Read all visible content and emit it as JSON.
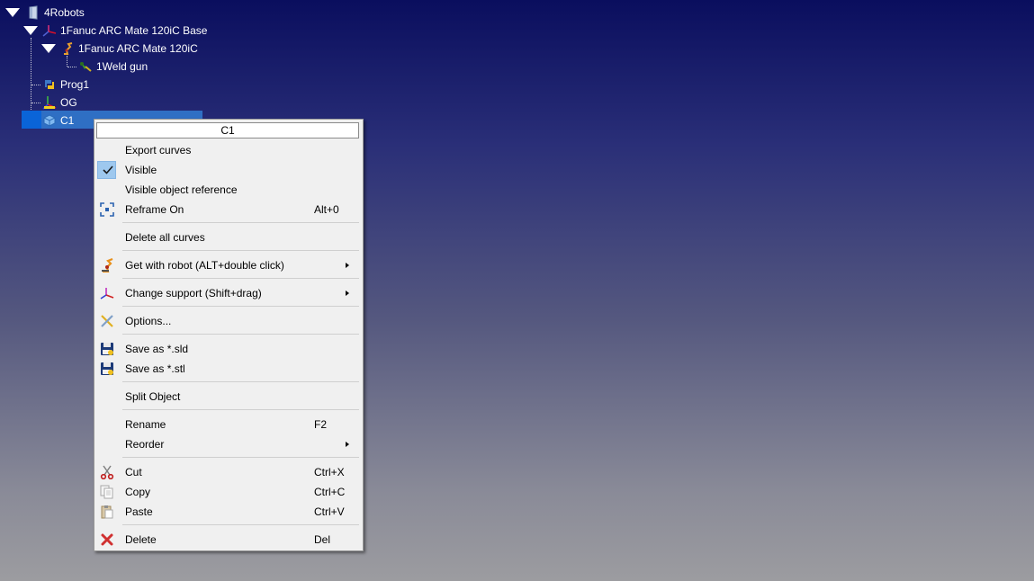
{
  "tree": {
    "root": "4Robots",
    "base": "1Fanuc ARC Mate 120iC Base",
    "robot": "1Fanuc ARC Mate 120iC",
    "tool": "1Weld gun",
    "prog": "Prog1",
    "og": "OG",
    "selected": "C1"
  },
  "menu": {
    "title": "C1",
    "items": {
      "export_curves": "Export curves",
      "visible": "Visible",
      "visible_ref": "Visible object reference",
      "reframe": "Reframe On",
      "reframe_sc": "Alt+0",
      "delete_curves": "Delete all curves",
      "get_robot": "Get with robot (ALT+double click)",
      "change_support": "Change support (Shift+drag)",
      "options": "Options...",
      "save_sld": "Save as *.sld",
      "save_stl": "Save as *.stl",
      "split": "Split Object",
      "rename": "Rename",
      "rename_sc": "F2",
      "reorder": "Reorder",
      "cut": "Cut",
      "cut_sc": "Ctrl+X",
      "copy": "Copy",
      "copy_sc": "Ctrl+C",
      "paste": "Paste",
      "paste_sc": "Ctrl+V",
      "delete": "Delete",
      "delete_sc": "Del"
    },
    "visible_checked": true
  },
  "icons": {
    "root": "station-icon",
    "base": "frame-axes-icon",
    "robot": "robot-arm-icon",
    "tool": "weld-gun-icon",
    "prog": "python-program-icon",
    "og": "reference-frame-icon",
    "selected": "object-cube-icon"
  },
  "colors": {
    "selection": "#2f6fc4",
    "menu_bg": "#f0f0f0",
    "check_highlight": "#9ec8ee"
  }
}
